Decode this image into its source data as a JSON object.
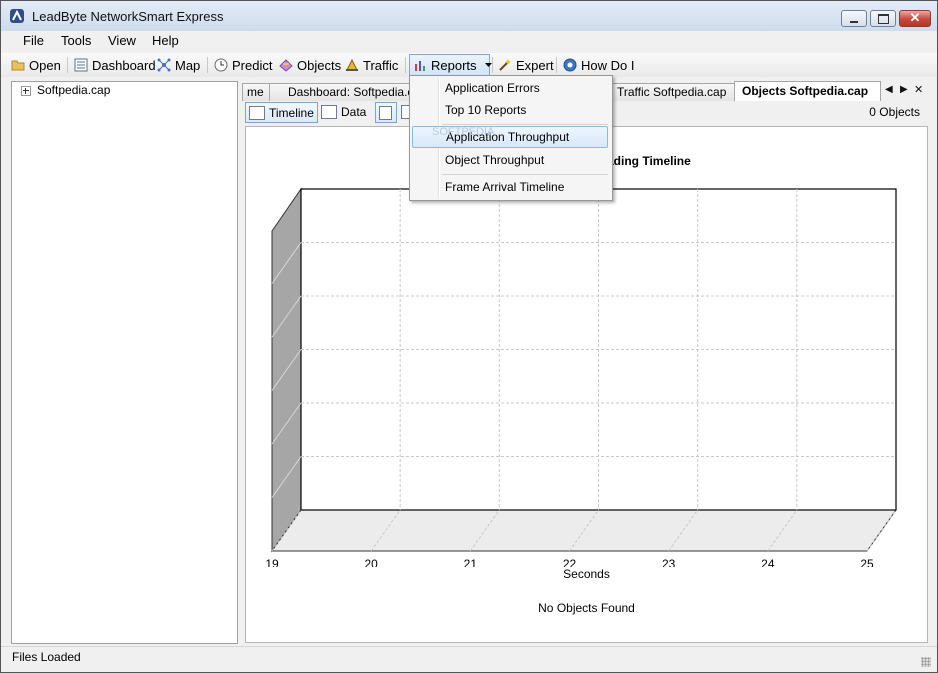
{
  "window": {
    "title": "LeadByte NetworkSmart Express",
    "close_glyph": "✕"
  },
  "menu": [
    "File",
    "Tools",
    "View",
    "Help"
  ],
  "toolbar": {
    "open": "Open",
    "dashboard": "Dashboard",
    "map": "Map",
    "predict": "Predict",
    "objects": "Objects",
    "traffic": "Traffic",
    "reports": "Reports",
    "expert": "Expert",
    "howdoi": "How Do I"
  },
  "tree": {
    "root": "Softpedia.cap"
  },
  "tabs": [
    {
      "label": "me"
    },
    {
      "label": "Dashboard: Softpedia.cap"
    },
    {
      "label": "Traffic Softpedia.cap"
    },
    {
      "label": "Objects Softpedia.cap",
      "active": true
    }
  ],
  "tab_nav": {
    "prev": "◀",
    "next": "▶",
    "close": "✕"
  },
  "subtoolbar": {
    "timeline": "Timeline",
    "data": "Data",
    "count": "0 Objects"
  },
  "dropdown": {
    "items": [
      "Application Errors",
      "Top 10 Reports",
      "Application Throughput",
      "Object Throughput",
      "Frame Arrival Timeline"
    ],
    "highlighted": "Application Throughput"
  },
  "watermark": "SOFTPEDIA",
  "chart_data": {
    "type": "scatter",
    "title_visible_fragment": "ading Timeline",
    "xlabel": "Seconds",
    "ylabel": "",
    "xlim": [
      19,
      25
    ],
    "x_ticks": [
      "19",
      "20",
      "21",
      "22",
      "23",
      "24",
      "25"
    ],
    "series": [],
    "grid": true,
    "style": "3d",
    "empty_message": "No Objects Found"
  },
  "status": {
    "text": "Files Loaded"
  },
  "colors": {
    "dropdown_highlight": "#d6e8fa",
    "active_button": "#dbe9f7",
    "chart_wall": "#a6a6a6"
  }
}
